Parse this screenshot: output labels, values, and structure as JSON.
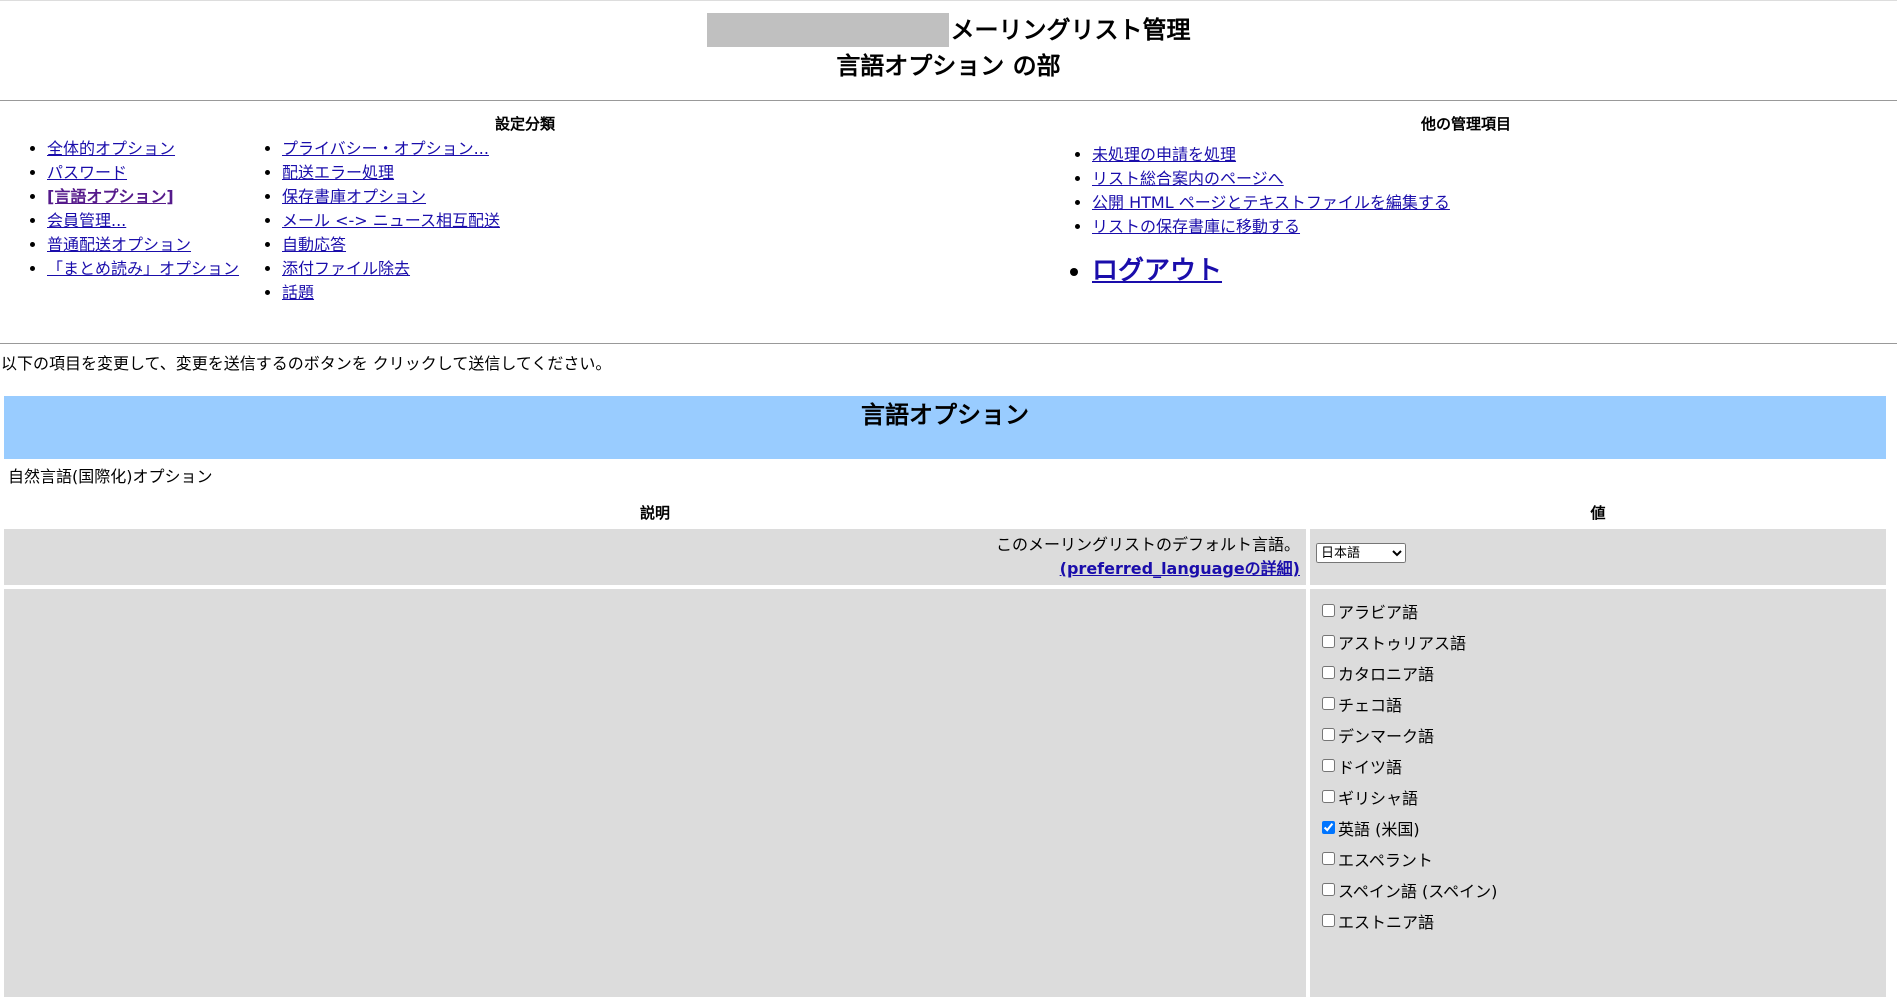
{
  "header": {
    "title": "メーリングリスト管理",
    "subtitle": "言語オプション の部"
  },
  "nav": {
    "settings_heading": "設定分類",
    "settings_col1": [
      {
        "label": "全体的オプション",
        "current": false
      },
      {
        "label": "パスワード",
        "current": false
      },
      {
        "label": "[言語オプション]",
        "current": true
      },
      {
        "label": "会員管理...",
        "current": false
      },
      {
        "label": "普通配送オプション",
        "current": false
      },
      {
        "label": "「まとめ読み」オプション",
        "current": false
      }
    ],
    "settings_col2": [
      "プライバシー・オプション...",
      "配送エラー処理",
      "保存書庫オプション",
      "メール <-> ニュース相互配送",
      "自動応答",
      "添付ファイル除去",
      "話題"
    ],
    "other_heading": "他の管理項目",
    "other_items": [
      "未処理の申請を処理",
      "リスト総合案内のページへ",
      "公開 HTML ページとテキストファイルを編集する",
      "リストの保存書庫に移動する"
    ],
    "logout_label": "ログアウト"
  },
  "instructions": "以下の項目を変更して、変更を送信するのボタンを クリックして送信してください。",
  "section": {
    "title": "言語オプション",
    "description": "自然言語(国際化)オプション"
  },
  "table": {
    "col_description": "説明",
    "col_value": "値",
    "default_language": {
      "description": "このメーリングリストのデフォルト言語。",
      "details_link": "(preferred_languageの詳細)",
      "selected": "日本語"
    },
    "available_languages": [
      {
        "label": "アラビア語",
        "checked": false
      },
      {
        "label": "アストゥリアス語",
        "checked": false
      },
      {
        "label": "カタロニア語",
        "checked": false
      },
      {
        "label": "チェコ語",
        "checked": false
      },
      {
        "label": "デンマーク語",
        "checked": false
      },
      {
        "label": "ドイツ語",
        "checked": false
      },
      {
        "label": "ギリシャ語",
        "checked": false
      },
      {
        "label": "英語 (米国)",
        "checked": true
      },
      {
        "label": "エスペラント",
        "checked": false
      },
      {
        "label": "スペイン語 (スペイン)",
        "checked": false
      },
      {
        "label": "エストニア語",
        "checked": false
      }
    ]
  }
}
